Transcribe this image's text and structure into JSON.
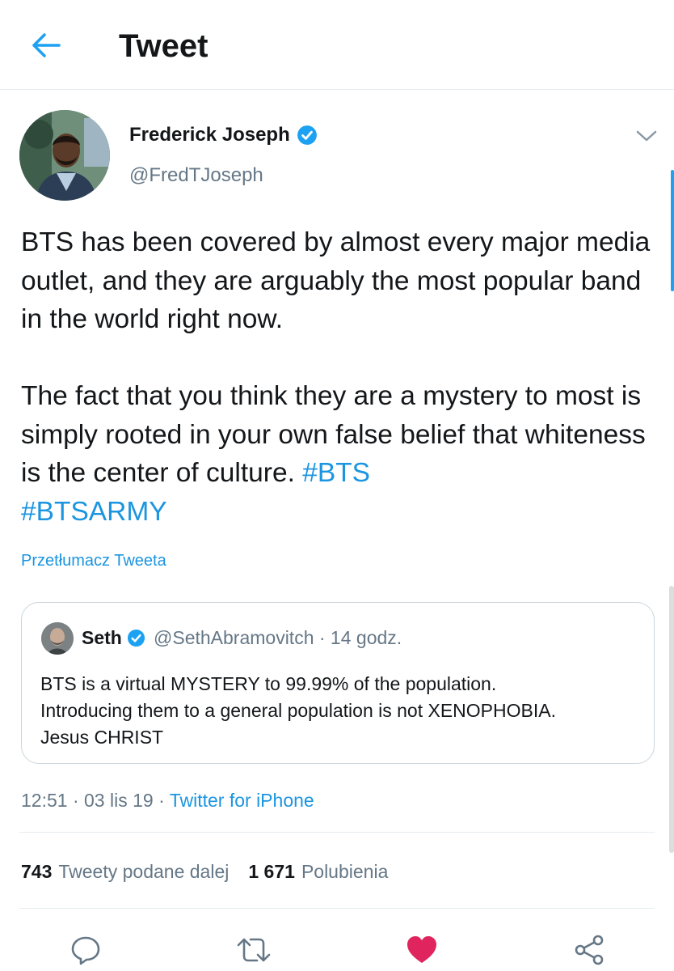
{
  "header": {
    "title": "Tweet"
  },
  "tweet": {
    "author_name": "Frederick Joseph",
    "author_handle": "@FredTJoseph",
    "paragraph1": "BTS has been covered by almost every major media outlet, and they are arguably the most popular band in the world right now.",
    "paragraph2_text": "The fact that you think they are a mystery to most is simply rooted in your own false belief that whiteness is the center of culture.",
    "hashtag1": "#BTS",
    "hashtag2": "#BTSARMY",
    "translate_label": "Przetłumacz Tweeta",
    "time": "12:51",
    "date": "03 lis 19",
    "client": "Twitter for iPhone"
  },
  "quote": {
    "name": "Seth",
    "handle": "@SethAbramovitch · 14 godz.",
    "line1": "BTS is a virtual MYSTERY to 99.99% of the population.",
    "line2": "Introducing them to a general population is not XENOPHOBIA.",
    "line3": "Jesus CHRIST"
  },
  "stats": {
    "retweets_count": "743",
    "retweets_label": "Tweety podane dalej",
    "likes_count": "1 671",
    "likes_label": "Polubienia"
  },
  "icons": {
    "back": "arrow-left-icon",
    "verified": "verified-badge-icon",
    "more": "chevron-down-icon",
    "reply": "reply-icon",
    "retweet": "retweet-icon",
    "like": "heart-icon",
    "share": "share-icon"
  },
  "colors": {
    "accent": "#1da1f2",
    "link": "#1b95e0",
    "like": "#e0245e",
    "secondary_text": "#657786"
  }
}
